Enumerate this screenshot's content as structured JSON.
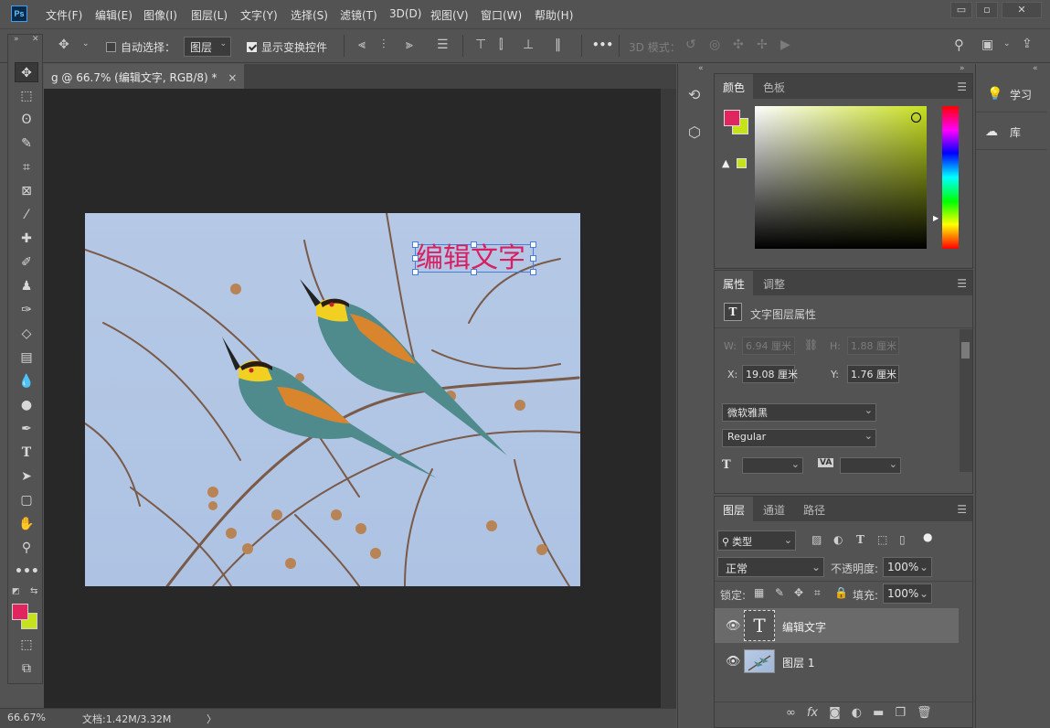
{
  "app": {
    "logo": "Ps"
  },
  "menu": [
    "文件(F)",
    "编辑(E)",
    "图像(I)",
    "图层(L)",
    "文字(Y)",
    "选择(S)",
    "滤镜(T)",
    "3D(D)",
    "视图(V)",
    "窗口(W)",
    "帮助(H)"
  ],
  "window_buttons": {
    "minimize": "▭",
    "maximize": "▫",
    "close": "✕"
  },
  "options": {
    "auto_select_label": "自动选择：",
    "auto_select_checked": false,
    "auto_select_target": "图层",
    "show_transform_label": "显示变换控件",
    "show_transform_checked": true,
    "more": "•••",
    "mode_3d_label": "3D 模式："
  },
  "document": {
    "tab_title": "g @ 66.7% (编辑文字, RGB/8) *",
    "close": "×",
    "overlay_text": "编辑文字",
    "text_color": "#d81f62"
  },
  "status": {
    "zoom": "66.67%",
    "doc_info": "文档:1.42M/3.32M",
    "arrow": "〉"
  },
  "tools": [
    "move-tool",
    "marquee-tool",
    "lasso-tool",
    "quick-select-tool",
    "crop-tool",
    "frame-tool",
    "eyedropper-tool",
    "healing-tool",
    "brush-tool",
    "stamp-tool",
    "history-brush-tool",
    "eraser-tool",
    "gradient-tool",
    "blur-tool",
    "dodge-tool",
    "pen-tool",
    "type-tool",
    "path-select-tool",
    "shape-tool",
    "hand-tool",
    "zoom-tool",
    "more-tools",
    "color-swatches",
    "quick-mask",
    "screen-mode"
  ],
  "colors": {
    "foreground": "#e0255f",
    "background": "#c6e21d",
    "accent": "#4a7ed6"
  },
  "color_panel": {
    "tabs": [
      "颜色",
      "色板"
    ],
    "active": 0,
    "picker_hue": "#c8e021"
  },
  "properties_panel": {
    "tabs": [
      "属性",
      "调整"
    ],
    "active": 0,
    "header": "文字图层属性",
    "w_label": "W:",
    "w_value": "6.94 厘米",
    "h_label": "H:",
    "h_value": "1.88 厘米",
    "x_label": "X:",
    "x_value": "19.08 厘米",
    "y_label": "Y:",
    "y_value": "1.76 厘米",
    "font_family": "微软雅黑",
    "font_style": "Regular",
    "size_icon": "T",
    "tracking_icon": "VA"
  },
  "layers_panel": {
    "tabs": [
      "图层",
      "通道",
      "路径"
    ],
    "active": 0,
    "filter": "类型",
    "blend_mode": "正常",
    "opacity_label": "不透明度:",
    "opacity_value": "100%",
    "lock_label": "锁定:",
    "fill_label": "填充:",
    "fill_value": "100%",
    "layers": [
      {
        "name": "编辑文字",
        "thumb": "T",
        "selected": true
      },
      {
        "name": "图层 1",
        "thumb": "",
        "selected": false
      }
    ],
    "footer_icons": [
      "∞",
      "fx",
      "◙",
      "◐",
      "▬",
      "❐",
      "🗑"
    ]
  },
  "right_panel": {
    "items": [
      {
        "label": "学习",
        "icon": "lightbulb-icon"
      },
      {
        "label": "库",
        "icon": "cloud-icon"
      }
    ]
  }
}
